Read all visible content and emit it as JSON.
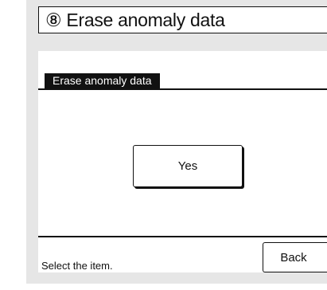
{
  "title": {
    "number": "⑧",
    "label": "Erase anomaly data"
  },
  "screen": {
    "header_label": "Erase anomaly data",
    "yes_label": "Yes",
    "back_label": "Back",
    "status_text": "Select the item."
  },
  "colors": {
    "panel_background": "#e6e6e6",
    "screen_background": "#ffffff",
    "foreground": "#111111"
  }
}
